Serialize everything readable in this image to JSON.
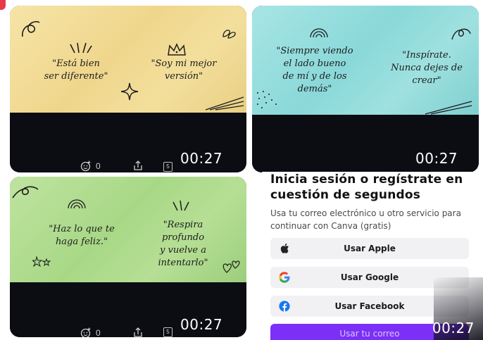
{
  "colors": {
    "card_dark": "#0b0d13",
    "paper_yellow": "#f3df9c",
    "paper_cyan": "#9fe1e0",
    "paper_green": "#b6df95",
    "email_button": "#7b2ff7",
    "accent": "#e8394a"
  },
  "cards": [
    {
      "quotes": [
        "\"Está bien\nser diferente\"",
        "\"Soy mi mejor\nversión\""
      ],
      "icons": [
        "crown-icon",
        "sparkle-star-icon",
        "rays-icon",
        "swirl-icon",
        "leaves-icon",
        "stroke-lines-icon"
      ],
      "duration": "00:27",
      "reactions": "0",
      "pages": "5"
    },
    {
      "quotes": [
        "\"Siempre viendo\nel lado bueno\nde mí y de los\ndemás\"",
        "\"Inspírate.\nNunca dejes de\ncrear\""
      ],
      "icons": [
        "rainbow-icon",
        "leaf-doodle-icon",
        "dots-icon",
        "stroke-lines-icon"
      ],
      "duration": "00:27"
    },
    {
      "quotes": [
        "\"Haz lo que te\nhaga feliz.\"",
        "\"Respira\nprofundo\ny vuelve a\nintentarlo\""
      ],
      "icons": [
        "rainbow-icon",
        "rays-icon",
        "hearts-icon",
        "stars-doodle-icon",
        "swirl-icon"
      ],
      "duration": "00:27",
      "reactions": "0",
      "pages": "5"
    }
  ],
  "login": {
    "title": "Inicia sesión o regístrate en cuestión de segundos",
    "subtitle": "Usa tu correo electrónico u otro servicio para continuar con Canva (gratis)",
    "buttons": {
      "apple": "Usar Apple",
      "google": "Usar Google",
      "facebook": "Usar Facebook",
      "email": "Usar tu correo"
    },
    "duration": "00:27"
  }
}
